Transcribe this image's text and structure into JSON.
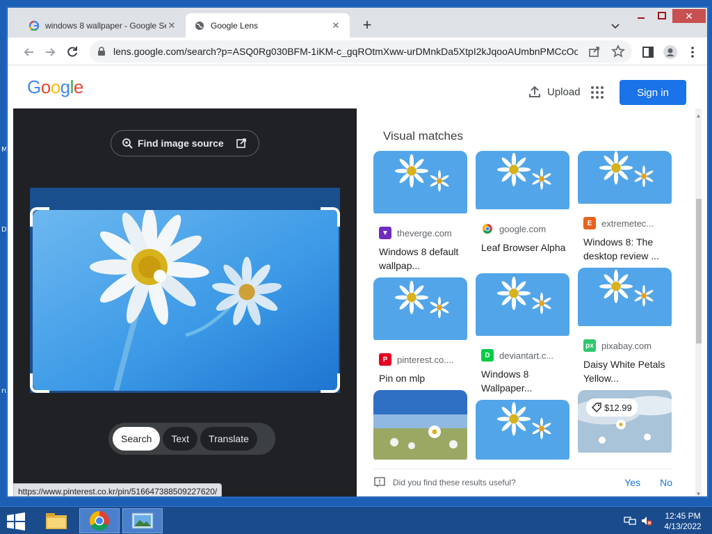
{
  "desktop": {
    "edge_glyphs": [
      "M",
      "D",
      "ru"
    ]
  },
  "browser": {
    "tabs": [
      {
        "title": "windows 8 wallpaper - Google Se",
        "favicon": "google-icon"
      },
      {
        "title": "Google Lens",
        "favicon": "globe-icon"
      }
    ],
    "url": "lens.google.com/search?p=ASQ0Rg030BFM-1iKM-c_gqROtmXww-urDMnkDa5XtpI2kJqooAUmbnPMCcOo...",
    "status_url": "https://www.pinterest.co.kr/pin/516647388509227620/"
  },
  "header": {
    "logo": {
      "letters": [
        "G",
        "o",
        "o",
        "g",
        "l",
        "e"
      ],
      "colors": [
        "#4285F4",
        "#EA4335",
        "#FBBC05",
        "#4285F4",
        "#34A853",
        "#EA4335"
      ]
    },
    "upload_label": "Upload",
    "signin_label": "Sign in"
  },
  "lens": {
    "find_source_label": "Find image source",
    "modes": [
      "Search",
      "Text",
      "Translate"
    ],
    "active_mode": "Search"
  },
  "results": {
    "heading": "Visual matches",
    "cards": [
      {
        "source": "theverge.com",
        "title": "Windows 8 default wallpap...",
        "icon_color": "#6f2dbd",
        "icon_glyph": "▼",
        "variant": "daisy"
      },
      {
        "source": "google.com",
        "title": "Leaf Browser Alpha",
        "icon_color": "#ffffff",
        "icon_glyph": "",
        "variant": "daisy"
      },
      {
        "source": "extremetec...",
        "title": "Windows 8: The desktop review ...",
        "icon_color": "#e8621c",
        "icon_glyph": "E",
        "variant": "daisy"
      },
      {
        "source": "pinterest.co....",
        "title": "Pin on mlp",
        "icon_color": "#e60023",
        "icon_glyph": "P",
        "variant": "daisy"
      },
      {
        "source": "deviantart.c...",
        "title": "Windows 8 Wallpaper...",
        "icon_color": "#05cc47",
        "icon_glyph": "D",
        "variant": "daisy"
      },
      {
        "source": "pixabay.com",
        "title": "Daisy White Petals Yellow...",
        "icon_color": "#2ec66d",
        "icon_glyph": "px",
        "variant": "daisy"
      },
      {
        "source": "",
        "title": "",
        "icon_color": "",
        "icon_glyph": "",
        "variant": "field"
      },
      {
        "source": "",
        "title": "",
        "icon_color": "",
        "icon_glyph": "",
        "variant": "daisy"
      },
      {
        "source": "",
        "title": "",
        "icon_color": "",
        "icon_glyph": "",
        "variant": "sky",
        "price": "$12.99"
      }
    ],
    "feedback": {
      "question": "Did you find these results useful?",
      "yes": "Yes",
      "no": "No"
    }
  },
  "taskbar": {
    "time": "12:45 PM",
    "date": "4/13/2022"
  },
  "colors": {
    "accent": "#1a73e8",
    "dark_panel": "#202124",
    "taskbar": "#1a4b8c"
  }
}
